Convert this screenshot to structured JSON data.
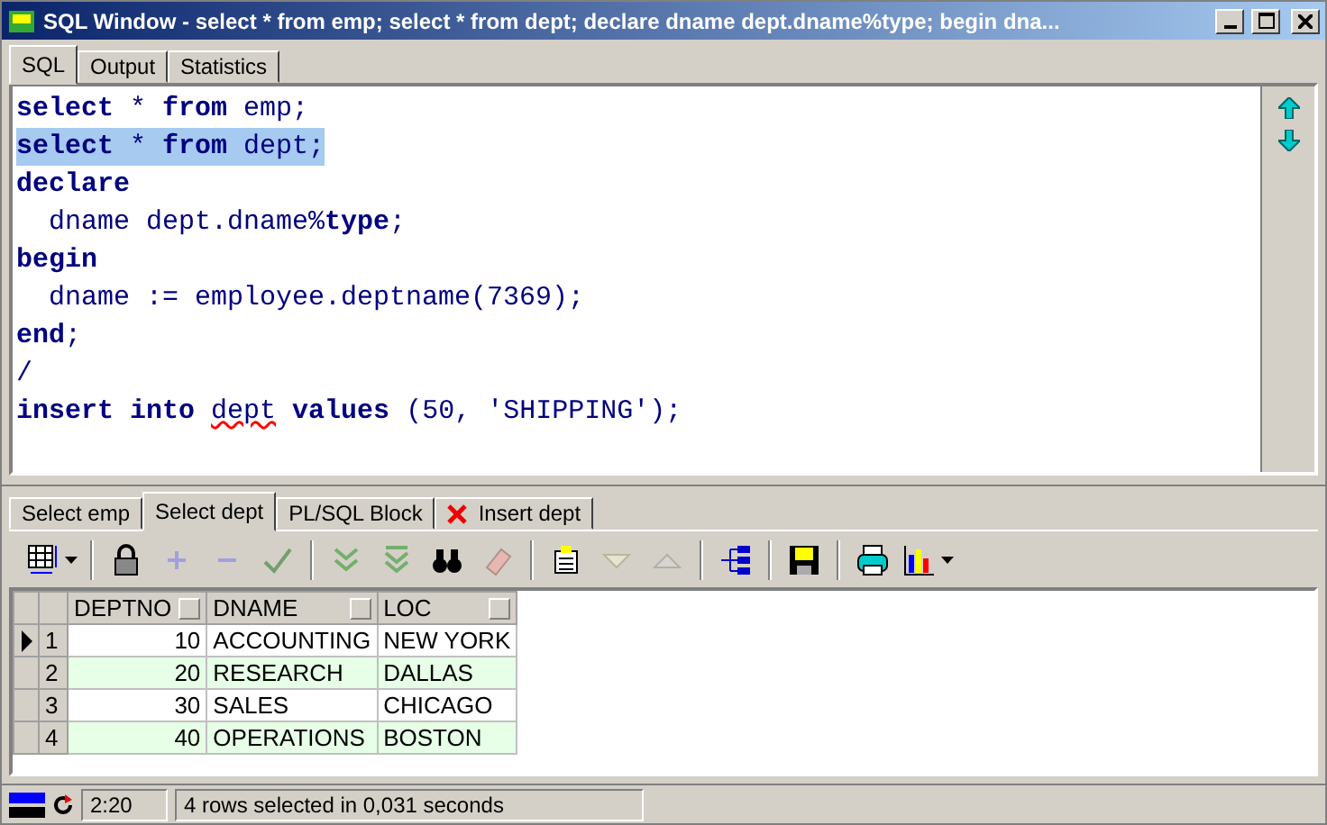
{
  "window": {
    "title": "SQL Window - select * from emp; select * from dept; declare dname dept.dname%type; begin dna..."
  },
  "tabs": [
    {
      "label": "SQL",
      "selected": true
    },
    {
      "label": "Output",
      "selected": false
    },
    {
      "label": "Statistics",
      "selected": false
    }
  ],
  "editor": {
    "lines": [
      {
        "selected": false,
        "tokens": [
          {
            "kind": "keyword",
            "text": "select"
          },
          {
            "kind": "plain",
            "text": " * "
          },
          {
            "kind": "keyword",
            "text": "from"
          },
          {
            "kind": "plain",
            "text": " emp;"
          }
        ]
      },
      {
        "selected": true,
        "tokens": [
          {
            "kind": "keyword",
            "text": "select"
          },
          {
            "kind": "plain",
            "text": " * "
          },
          {
            "kind": "keyword",
            "text": "from"
          },
          {
            "kind": "plain",
            "text": " dept;"
          }
        ]
      },
      {
        "selected": false,
        "tokens": [
          {
            "kind": "keyword",
            "text": "declare"
          }
        ]
      },
      {
        "selected": false,
        "tokens": [
          {
            "kind": "plain",
            "text": "  dname dept.dname%"
          },
          {
            "kind": "keyword",
            "text": "type"
          },
          {
            "kind": "plain",
            "text": ";"
          }
        ]
      },
      {
        "selected": false,
        "tokens": [
          {
            "kind": "keyword",
            "text": "begin"
          }
        ]
      },
      {
        "selected": false,
        "tokens": [
          {
            "kind": "plain",
            "text": "  dname := employee.deptname(7369);"
          }
        ]
      },
      {
        "selected": false,
        "tokens": [
          {
            "kind": "keyword",
            "text": "end"
          },
          {
            "kind": "plain",
            "text": ";"
          }
        ]
      },
      {
        "selected": false,
        "tokens": [
          {
            "kind": "plain",
            "text": "/"
          }
        ]
      },
      {
        "selected": false,
        "tokens": [
          {
            "kind": "keyword",
            "text": "insert"
          },
          {
            "kind": "keyword",
            "text": " into "
          },
          {
            "kind": "plain",
            "text": "dept",
            "misspelled": true
          },
          {
            "kind": "keyword",
            "text": " values"
          },
          {
            "kind": "plain",
            "text": " (50, 'SHIPPING');"
          }
        ]
      }
    ]
  },
  "result_tabs": [
    {
      "label": "Select emp",
      "selected": false,
      "failed": false
    },
    {
      "label": "Select dept",
      "selected": true,
      "failed": false
    },
    {
      "label": "PL/SQL Block",
      "selected": false,
      "failed": false
    },
    {
      "label": "Insert dept",
      "selected": false,
      "failed": true
    }
  ],
  "toolbar": [
    {
      "kind": "grid",
      "disabled": false,
      "dropdown": true
    },
    {
      "kind": "separator"
    },
    {
      "kind": "lock",
      "disabled": false
    },
    {
      "kind": "plus",
      "disabled": true
    },
    {
      "kind": "minus",
      "disabled": true
    },
    {
      "kind": "check",
      "disabled": true
    },
    {
      "kind": "separator"
    },
    {
      "kind": "next",
      "disabled": true
    },
    {
      "kind": "last",
      "disabled": true
    },
    {
      "kind": "binoculars",
      "disabled": false
    },
    {
      "kind": "eraser",
      "disabled": true
    },
    {
      "kind": "separator"
    },
    {
      "kind": "export",
      "disabled": false
    },
    {
      "kind": "down",
      "disabled": true
    },
    {
      "kind": "up",
      "disabled": true
    },
    {
      "kind": "separator"
    },
    {
      "kind": "tree",
      "disabled": false
    },
    {
      "kind": "separator"
    },
    {
      "kind": "save",
      "disabled": false
    },
    {
      "kind": "separator"
    },
    {
      "kind": "printer",
      "disabled": false
    },
    {
      "kind": "chart",
      "disabled": false,
      "dropdown": true
    }
  ],
  "table": {
    "columns": [
      "DEPTNO",
      "DNAME",
      "LOC"
    ],
    "rows": [
      {
        "number": "1",
        "selected": true,
        "cells": [
          "10",
          "ACCOUNTING",
          "NEW YORK"
        ]
      },
      {
        "number": "2",
        "selected": false,
        "cells": [
          "20",
          "RESEARCH",
          "DALLAS"
        ]
      },
      {
        "number": "3",
        "selected": false,
        "cells": [
          "30",
          "SALES",
          "CHICAGO"
        ]
      },
      {
        "number": "4",
        "selected": false,
        "cells": [
          "40",
          "OPERATIONS",
          "BOSTON"
        ]
      }
    ]
  },
  "status_bar": {
    "position": "2:20",
    "message": "4 rows selected in 0,031 seconds"
  }
}
